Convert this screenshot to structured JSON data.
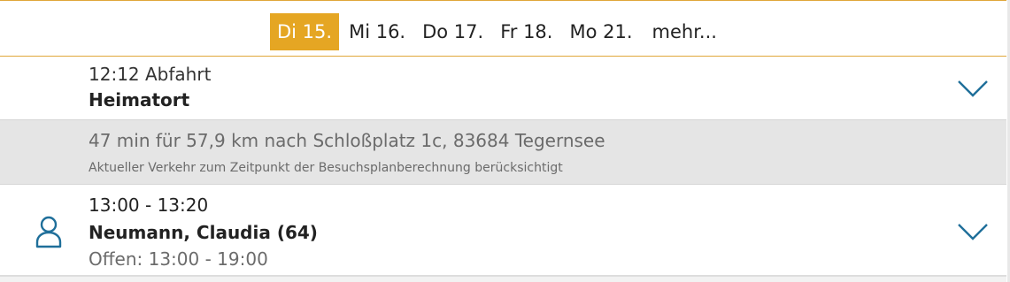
{
  "date_bar": {
    "tabs": [
      {
        "label": "Di 15.",
        "active": true
      },
      {
        "label": "Mi 16.",
        "active": false
      },
      {
        "label": "Do 17.",
        "active": false
      },
      {
        "label": "Fr 18.",
        "active": false
      },
      {
        "label": "Mo 21.",
        "active": false
      }
    ],
    "more_label": "mehr..."
  },
  "departure": {
    "time_label": "12:12 Abfahrt",
    "place": "Heimatort"
  },
  "travel": {
    "summary": "47 min für 57,9 km nach Schloßplatz 1c, 83684 Tegernsee",
    "note": "Aktueller Verkehr zum Zeitpunkt der Besuchsplanberechnung berücksichtigt"
  },
  "appointment": {
    "time_range": "13:00 - 13:20",
    "name": "Neumann, Claudia (64)",
    "open_hours": "Offen: 13:00 - 19:00"
  },
  "colors": {
    "accent": "#e5a623",
    "icon": "#1f6f9a",
    "muted_text": "#6b6b6b",
    "travel_bg": "#e5e5e5"
  },
  "icons": {
    "expand": "chevron-down-icon",
    "person": "person-icon"
  }
}
